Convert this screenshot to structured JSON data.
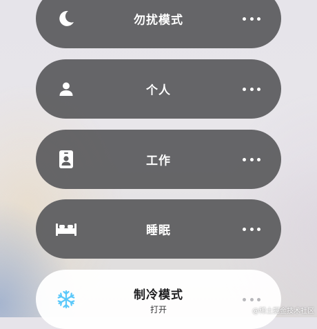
{
  "focus_modes": [
    {
      "label": "勿扰模式",
      "icon": "moon-icon"
    },
    {
      "label": "个人",
      "icon": "person-icon"
    },
    {
      "label": "工作",
      "icon": "badge-icon"
    },
    {
      "label": "睡眠",
      "icon": "bed-icon"
    }
  ],
  "active_mode": {
    "label": "制冷模式",
    "status": "打开",
    "icon": "snowflake-icon",
    "icon_color": "#5ac8fa"
  },
  "watermark": "@稀土掘金技术社区",
  "colors": {
    "pill_dark": "#606062",
    "pill_light": "#ffffff",
    "accent_snow": "#5ac8fa"
  }
}
